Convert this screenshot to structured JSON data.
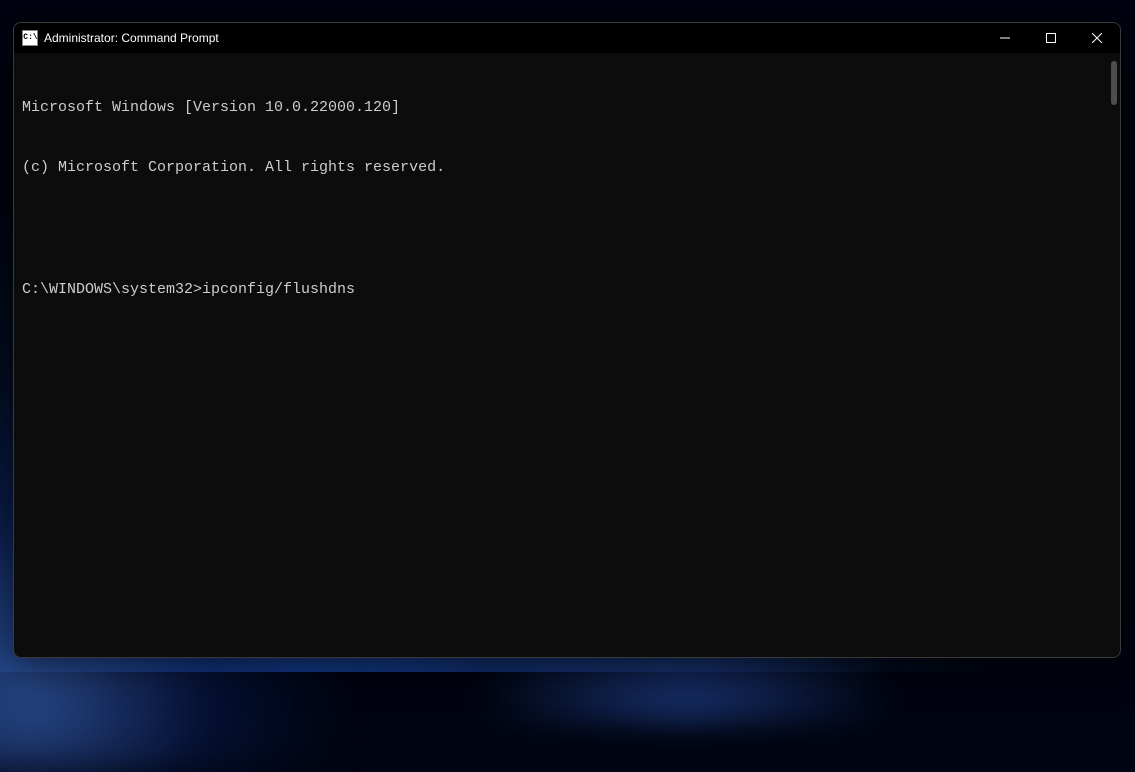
{
  "window": {
    "title": "Administrator: Command Prompt"
  },
  "terminal": {
    "line1": "Microsoft Windows [Version 10.0.22000.120]",
    "line2": "(c) Microsoft Corporation. All rights reserved.",
    "prompt": "C:\\WINDOWS\\system32>",
    "command": "ipconfig/flushdns"
  }
}
